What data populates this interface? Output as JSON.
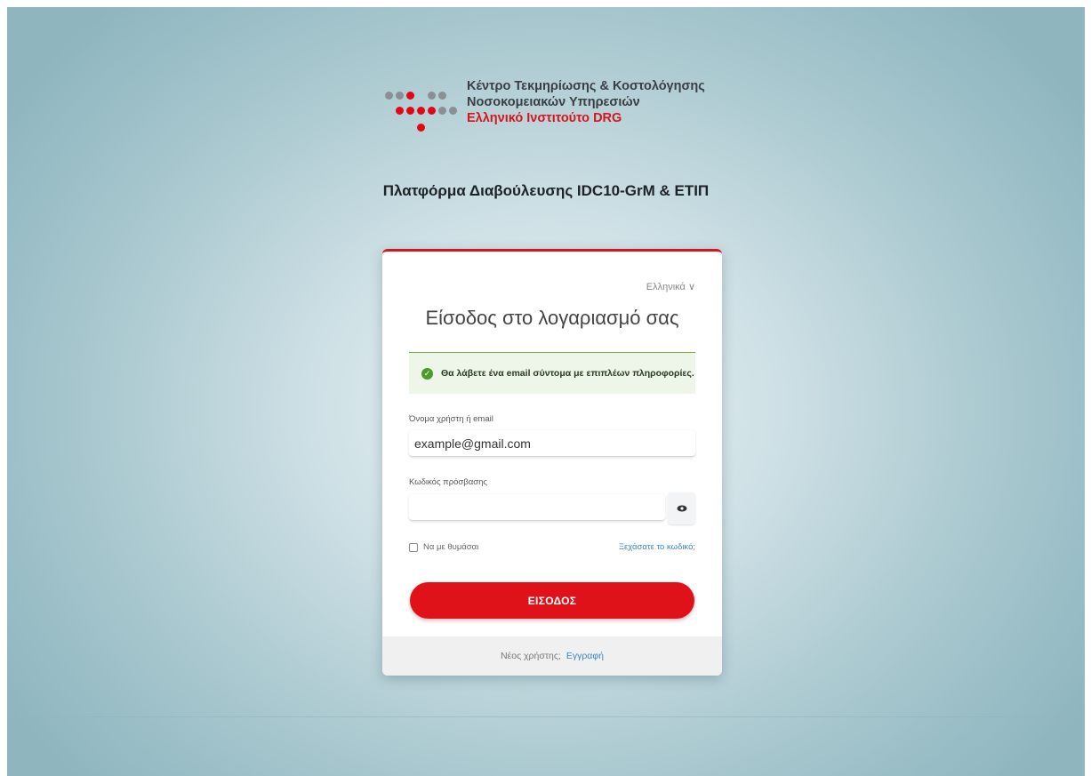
{
  "logo": {
    "line1": "Κέντρο Τεκμηρίωσης & Κοστολόγησης",
    "line2": "Νοσοκομειακών Υπηρεσιών",
    "line3": "Ελληνικό Ινστιτούτο DRG"
  },
  "platform_title": "Πλατφόρμα Διαβούλευσης IDC10-GrM & ΕΤΙΠ",
  "login": {
    "language": "Ελληνικά ∨",
    "title": "Είσοδος στο λογαριασμό σας",
    "alert": "Θα λάβετε ένα email σύντομα με επιπλέων πληροφορίες.",
    "username_label": "Όνομα χρήστη ή email",
    "username_value": "example@gmail.com",
    "password_label": "Κωδικός πρόσβασης",
    "password_value": "",
    "remember_label": "Να με θυμάσαι",
    "forgot_link": "Ξεχάσατε το κωδικό;",
    "submit_label": "ΕΙΣΟΔΟΣ",
    "new_user_text": "Νέος χρήστης;",
    "register_link": "Εγγραφή"
  },
  "colors": {
    "brand_red": "#e01219",
    "success_green": "#4c9a2a",
    "link_blue": "#3a86c8"
  },
  "icons": [
    "check-circle-icon",
    "eye-icon",
    "checkbox-icon"
  ]
}
